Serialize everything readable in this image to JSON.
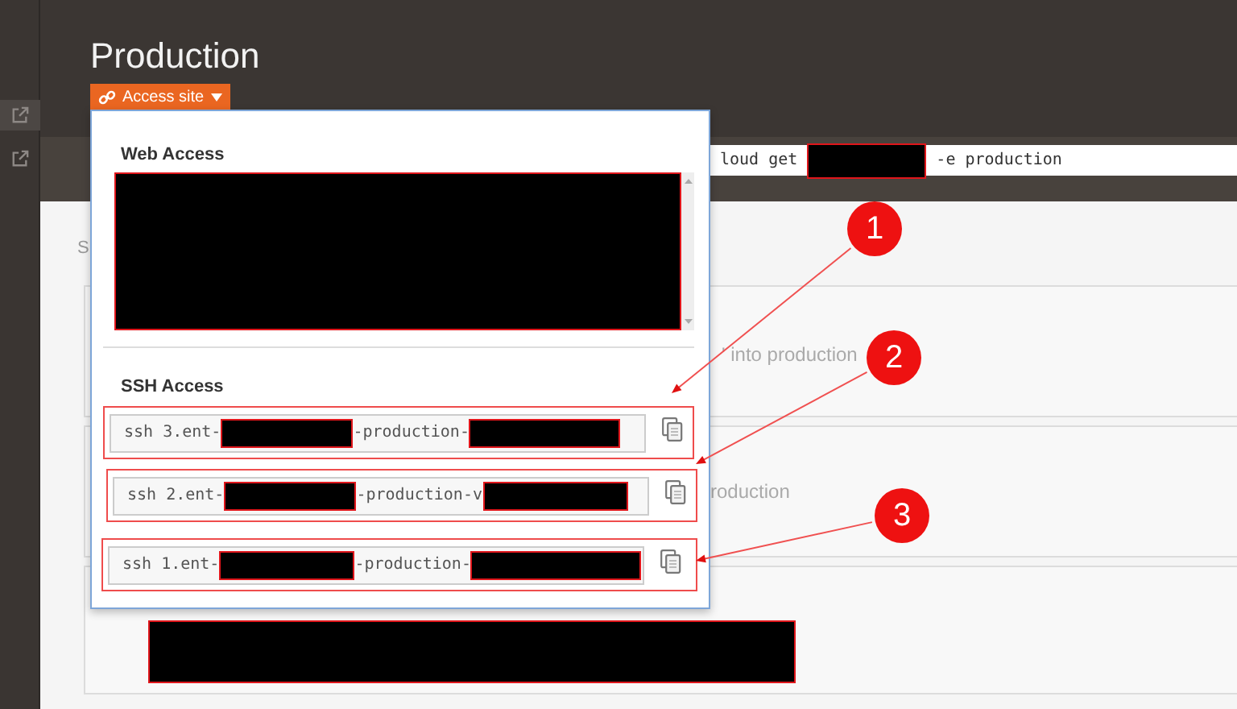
{
  "sidebar": {
    "items": [
      {
        "selected": true
      },
      {
        "selected": false
      }
    ]
  },
  "header": {
    "title": "Production",
    "access_button": {
      "label": "Access site",
      "expanded": true
    }
  },
  "command_bar": {
    "segments": [
      {
        "kind": "text",
        "text": "loud get"
      },
      {
        "kind": "redacted"
      },
      {
        "kind": "text",
        "text": "-e production"
      }
    ]
  },
  "content": {
    "section_label": "S",
    "cards": [
      {
        "kind": "text",
        "text": "' into production"
      },
      {
        "kind": "text",
        "text": "roduction"
      },
      {
        "kind": "redacted"
      }
    ]
  },
  "popup": {
    "web_access": {
      "heading": "Web Access"
    },
    "ssh_access": {
      "heading": "SSH Access",
      "rows": [
        {
          "segments": [
            {
              "kind": "text",
              "text": "ssh 3.ent-"
            },
            {
              "kind": "redacted"
            },
            {
              "kind": "text",
              "text": "-production-"
            },
            {
              "kind": "redacted"
            }
          ]
        },
        {
          "segments": [
            {
              "kind": "text",
              "text": "ssh 2.ent-"
            },
            {
              "kind": "redacted"
            },
            {
              "kind": "text",
              "text": "-production-v"
            },
            {
              "kind": "redacted"
            }
          ]
        },
        {
          "segments": [
            {
              "kind": "text",
              "text": "ssh 1.ent-"
            },
            {
              "kind": "redacted"
            },
            {
              "kind": "text",
              "text": "-production-"
            },
            {
              "kind": "redacted"
            }
          ]
        }
      ]
    }
  },
  "callouts": [
    {
      "label": "1"
    },
    {
      "label": "2"
    },
    {
      "label": "3"
    }
  ]
}
